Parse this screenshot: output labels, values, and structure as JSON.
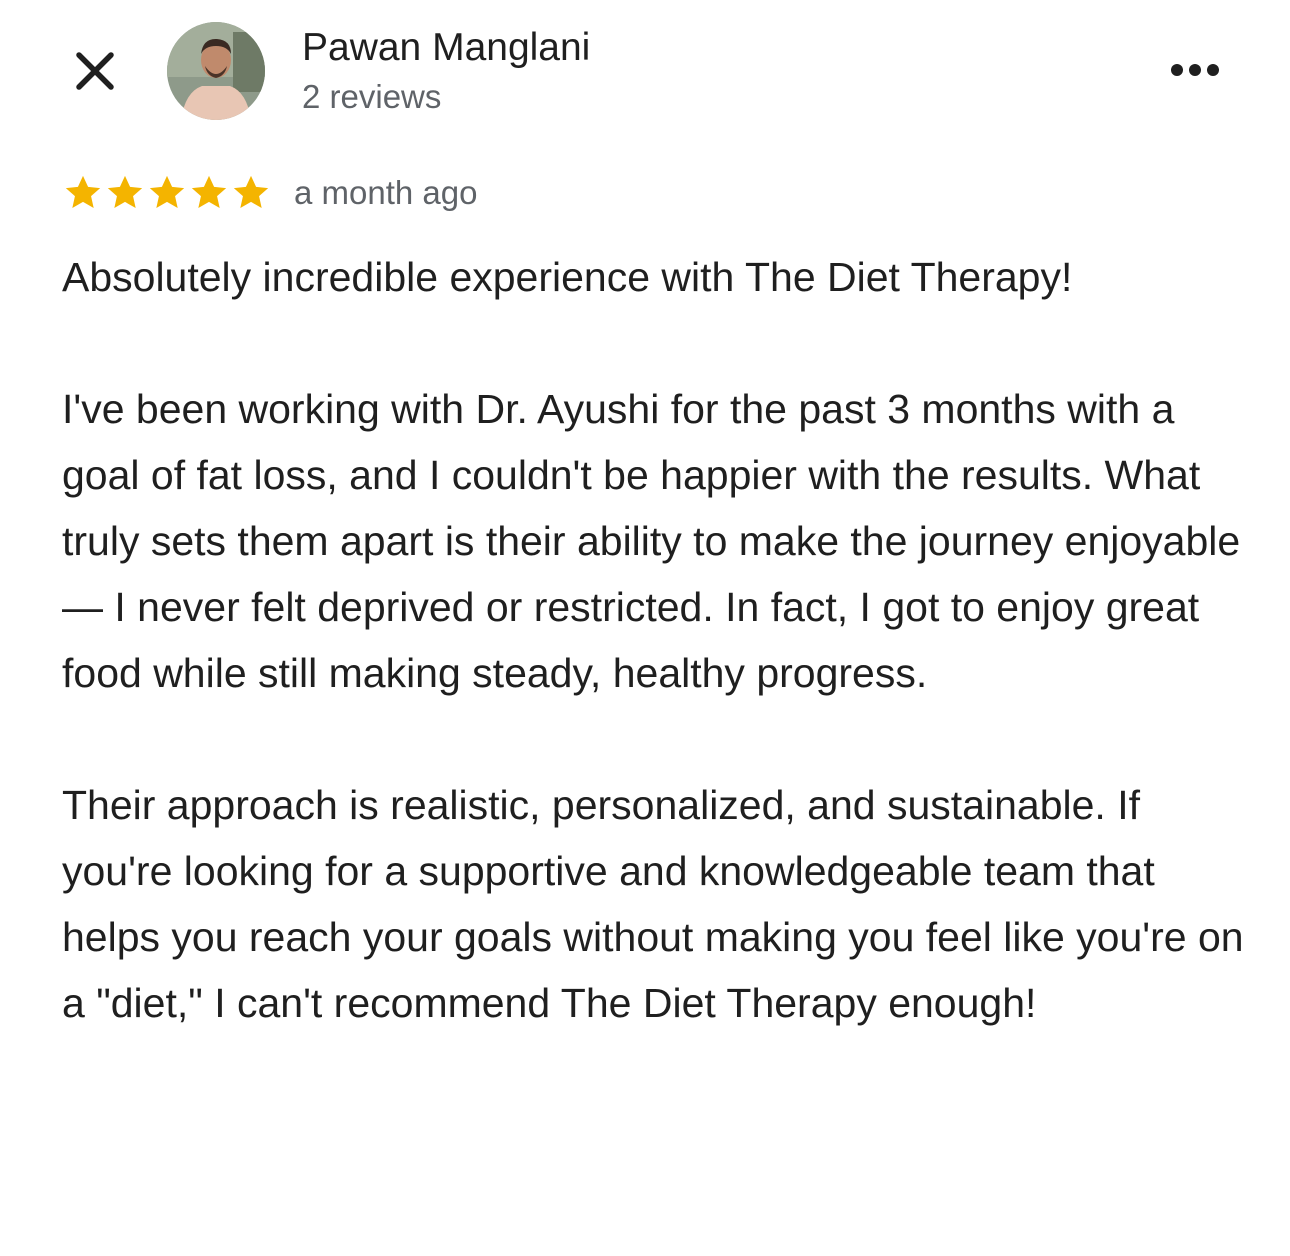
{
  "header": {
    "close_icon": "close-icon",
    "author_name": "Pawan Manglani",
    "review_count": "2 reviews",
    "more_icon": "more-horizontal-icon"
  },
  "review": {
    "rating": 5,
    "rating_max": 5,
    "star_color": "#f4b400",
    "time_ago": "a month ago",
    "paragraphs": [
      "Absolutely incredible experience with The Diet Therapy!",
      "I've been working with Dr. Ayushi for the past 3 months with a goal of fat loss, and I couldn't be happier with the results. What truly sets them apart is their ability to make the journey enjoyable — I never felt deprived or restricted. In fact, I got to enjoy great food while still making steady, healthy progress.",
      "Their approach is realistic, personalized, and sustainable. If you're looking for a supportive and knowledgeable team that helps you reach your goals without making you feel like you're on a \"diet,\" I can't recommend The Diet Therapy enough!"
    ]
  }
}
